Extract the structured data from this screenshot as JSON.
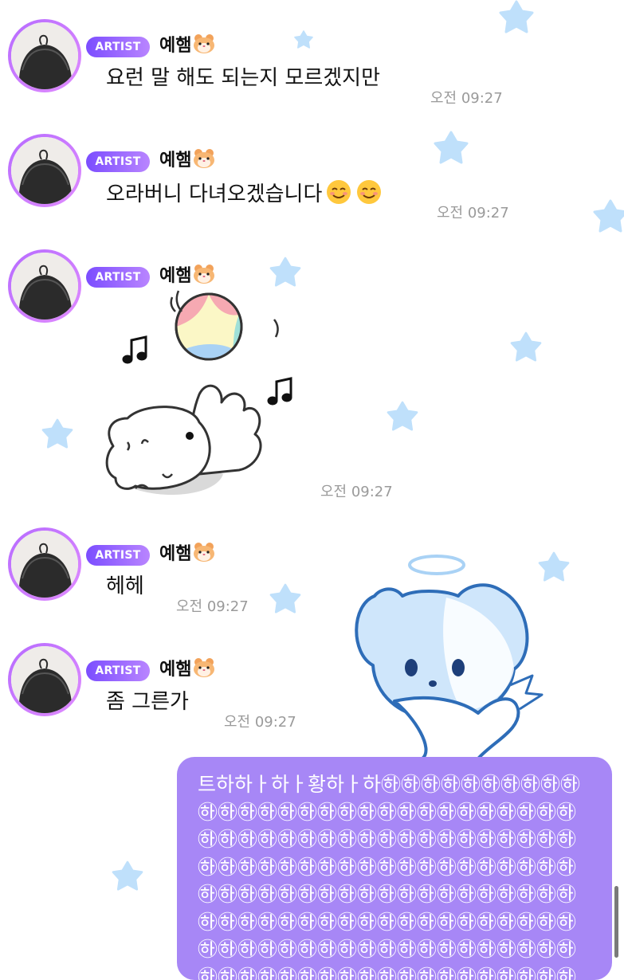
{
  "messages": [
    {
      "badge": "ARTIST",
      "sender": "예햄",
      "text": "요런 말 해도 되는지 모르겠지만",
      "time": "오전 09:27"
    },
    {
      "badge": "ARTIST",
      "sender": "예햄",
      "text": "오라버니 다녀오겠습니다",
      "time": "오전 09:27"
    },
    {
      "badge": "ARTIST",
      "sender": "예햄",
      "text": "",
      "time": "오전 09:27"
    },
    {
      "badge": "ARTIST",
      "sender": "예햄",
      "text": "헤헤",
      "time": "오전 09:27"
    },
    {
      "badge": "ARTIST",
      "sender": "예햄",
      "text": "좀 그른가",
      "time": "오전 09:27"
    }
  ],
  "my_message": {
    "text": "트하하ㅏ하ㅏ황하ㅏ하㉻㉻㉻㉻㉻㉻㉻㉻㉻㉻㉻㉻㉻㉻㉻㉻㉻㉻㉻㉻㉻㉻㉻㉻㉻㉻㉻㉻㉻㉻㉻㉻㉻㉻㉻㉻㉻㉻㉻㉻㉻㉻㉻㉻㉻㉻㉻㉻㉻㉻㉻㉻㉻㉻㉻㉻㉻㉻㉻㉻㉻㉻㉻㉻㉻㉻㉻㉻㉻㉻㉻㉻㉻㉻㉻㉻㉻㉻㉻㉻㉻㉻㉻㉻㉻㉻㉻㉻㉻㉻㉻㉻㉻㉻㉻㉻㉻㉻㉻㉻㉻㉻㉻㉻㉻㉻㉻㉻㉻㉻㉻㉻㉻㉻㉻㉻㉻㉻㉻㉻㉻㉻㉻㉻㉻㉻㉻㉻㉻㉻㉻㉻㉻㉻㉻㉻㉻㉻㉻㉻㉻㉻㉻"
  },
  "colors": {
    "badge_start": "#7b4dff",
    "badge_end": "#b985ff",
    "my_bubble": "#a787f6",
    "star": "#bfe0fb",
    "timestamp": "#9a9a9a"
  },
  "icons": [
    "hamster-emoji-icon",
    "smiling-face-emoji-icon",
    "ball-sticker",
    "angel-bear-background",
    "star-decoration"
  ]
}
